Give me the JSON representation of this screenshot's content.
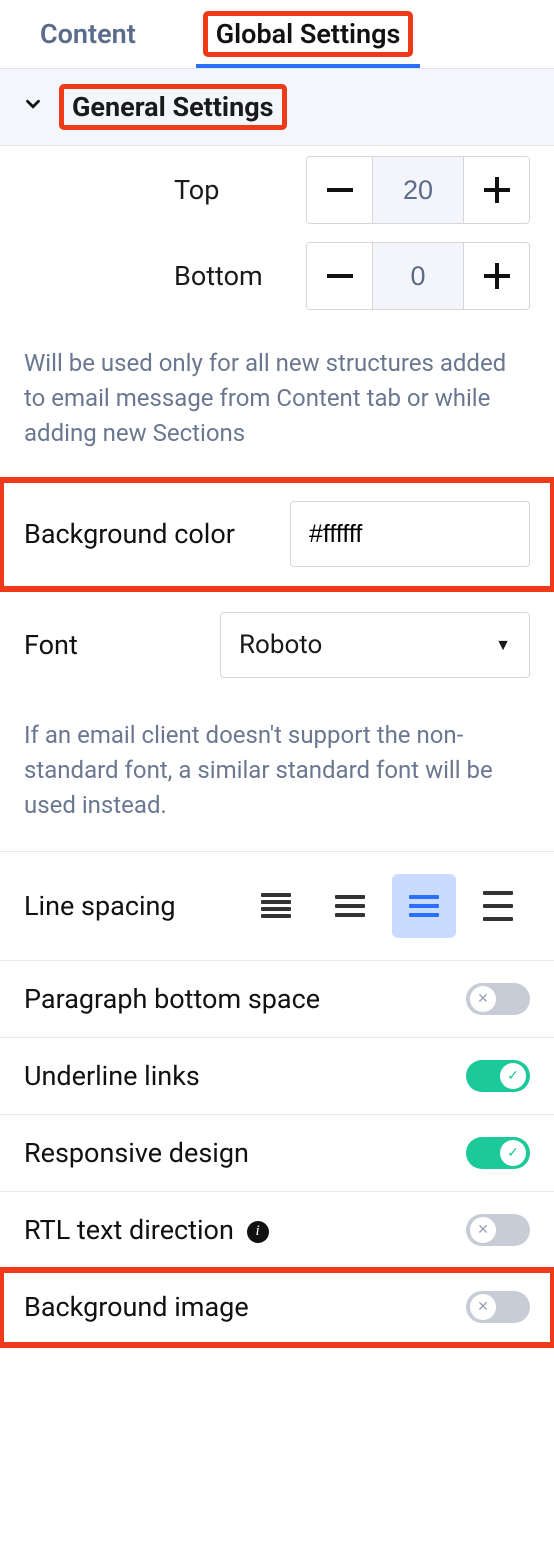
{
  "tabs": {
    "content": "Content",
    "global": "Global Settings"
  },
  "section": {
    "title": "General Settings"
  },
  "padding": {
    "top_label": "Top",
    "top_value": "20",
    "bottom_label": "Bottom",
    "bottom_value": "0",
    "helper": "Will be used only for all new structures added to email message from Content tab or while adding new Sections"
  },
  "bgcolor": {
    "label": "Background color",
    "value": "#ffffff"
  },
  "font": {
    "label": "Font",
    "value": "Roboto",
    "helper": "If an email client doesn't support the non-standard font, a similar standard font will be used instead."
  },
  "linespacing": {
    "label": "Line spacing"
  },
  "toggles": {
    "para_bottom": {
      "label": "Paragraph bottom space",
      "on": false
    },
    "underline": {
      "label": "Underline links",
      "on": true
    },
    "responsive": {
      "label": "Responsive design",
      "on": true
    },
    "rtl": {
      "label": "RTL text direction",
      "on": false
    },
    "bgimage": {
      "label": "Background image",
      "on": false
    }
  }
}
